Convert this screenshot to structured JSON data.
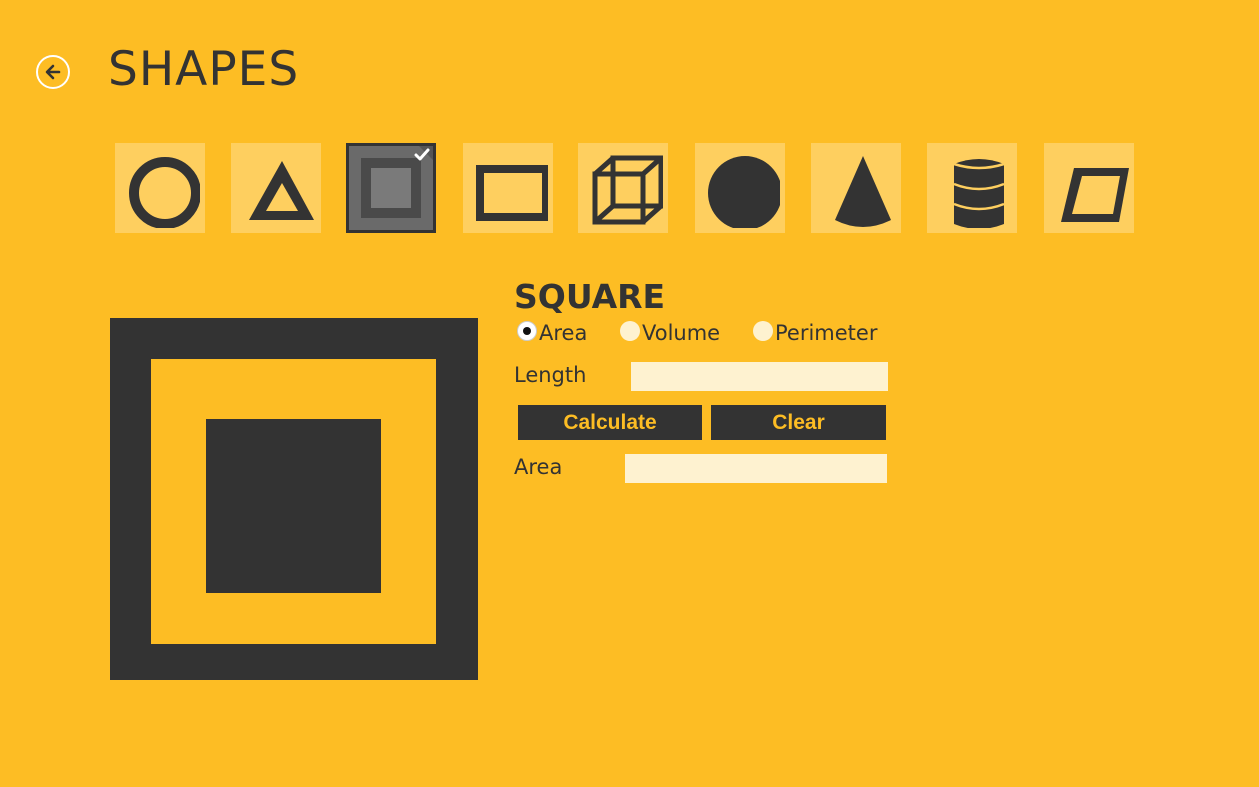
{
  "header": {
    "title": "SHAPES",
    "back_icon": "back-arrow-icon"
  },
  "shapes": [
    {
      "icon": "circle-icon",
      "selected": false
    },
    {
      "icon": "triangle-icon",
      "selected": false
    },
    {
      "icon": "square-icon",
      "selected": true
    },
    {
      "icon": "rectangle-icon",
      "selected": false
    },
    {
      "icon": "cube-icon",
      "selected": false
    },
    {
      "icon": "sphere-icon",
      "selected": false
    },
    {
      "icon": "cone-icon",
      "selected": false
    },
    {
      "icon": "cylinder-icon",
      "selected": false
    },
    {
      "icon": "parallelogram-icon",
      "selected": false
    }
  ],
  "form": {
    "shape_name": "SQUARE",
    "options": [
      {
        "label": "Area",
        "checked": true
      },
      {
        "label": "Volume",
        "checked": false
      },
      {
        "label": "Perimeter",
        "checked": false
      }
    ],
    "input_label": "Length",
    "input_value": "",
    "calculate_label": "Calculate",
    "clear_label": "Clear",
    "result_label": "Area",
    "result_value": ""
  },
  "colors": {
    "background": "#FDBD24",
    "dark": "#333333",
    "tile": "#FECF5F",
    "field": "#FEF2D0"
  }
}
